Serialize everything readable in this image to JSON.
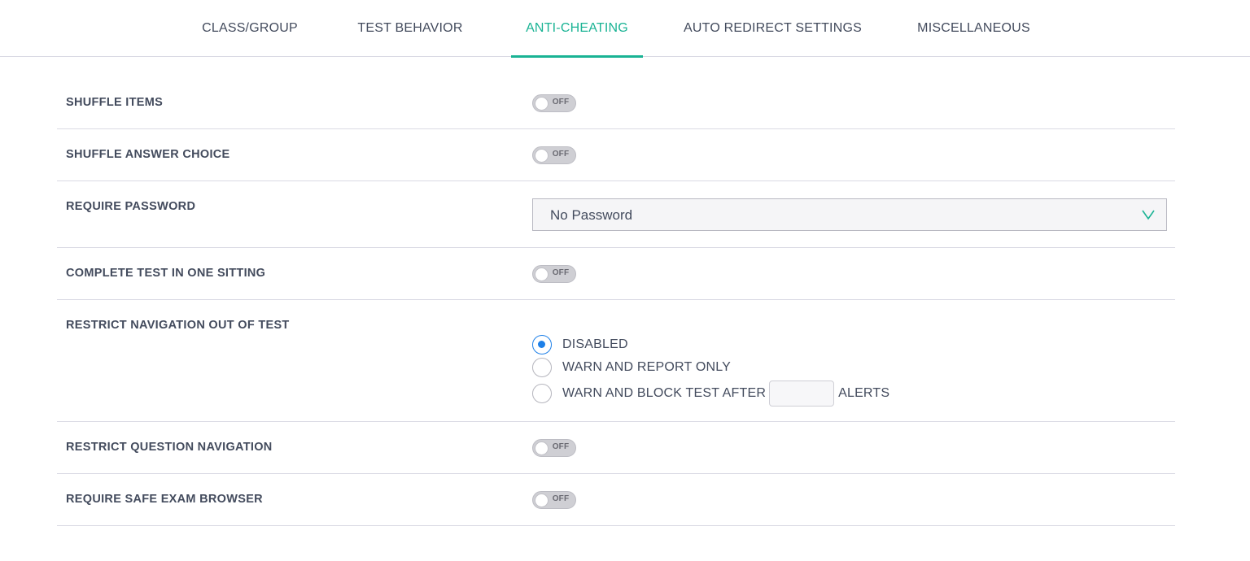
{
  "tabs": [
    {
      "label": "CLASS/GROUP",
      "active": false
    },
    {
      "label": "TEST BEHAVIOR",
      "active": false
    },
    {
      "label": "ANTI-CHEATING",
      "active": true
    },
    {
      "label": "AUTO REDIRECT SETTINGS",
      "active": false
    },
    {
      "label": "MISCELLANEOUS",
      "active": false
    }
  ],
  "settings": {
    "shuffle_items": {
      "label": "SHUFFLE ITEMS",
      "state": "OFF"
    },
    "shuffle_answer_choice": {
      "label": "SHUFFLE ANSWER CHOICE",
      "state": "OFF"
    },
    "require_password": {
      "label": "REQUIRE PASSWORD",
      "value": "No Password"
    },
    "complete_in_one_sitting": {
      "label": "COMPLETE TEST IN ONE SITTING",
      "state": "OFF"
    },
    "restrict_navigation": {
      "label": "RESTRICT NAVIGATION OUT OF TEST",
      "options": [
        {
          "label": "DISABLED",
          "selected": true
        },
        {
          "label": "WARN AND REPORT ONLY",
          "selected": false
        },
        {
          "label": "WARN AND BLOCK TEST AFTER",
          "selected": false,
          "suffix": "ALERTS",
          "input_value": ""
        }
      ]
    },
    "restrict_question_navigation": {
      "label": "RESTRICT QUESTION NAVIGATION",
      "state": "OFF"
    },
    "require_safe_exam_browser": {
      "label": "REQUIRE SAFE EXAM BROWSER",
      "state": "OFF"
    }
  },
  "colors": {
    "accent": "#1ab394",
    "radio_selected": "#1e80e8",
    "text": "#434b5d",
    "divider": "#dadae4"
  },
  "icons": {
    "dropdown": "chevron-down-icon"
  }
}
